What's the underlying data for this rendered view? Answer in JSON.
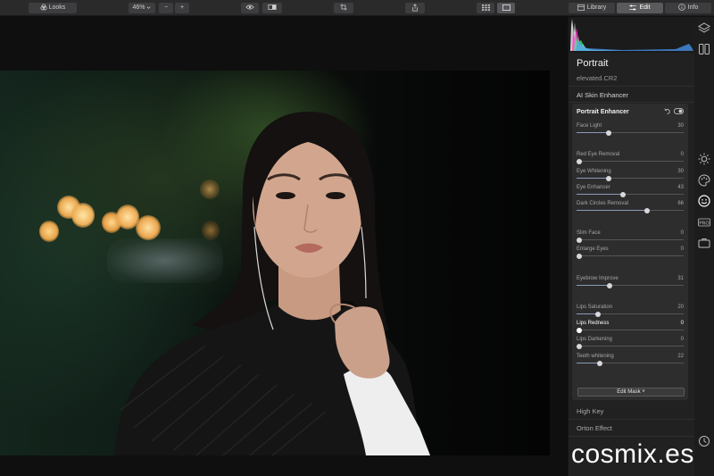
{
  "toolbar": {
    "looks_label": "Looks",
    "zoom_level": "46%",
    "zoom_out": "−",
    "zoom_in": "+"
  },
  "tabs": [
    {
      "label": "Library",
      "icon": "library-icon",
      "active": false
    },
    {
      "label": "Edit",
      "icon": "sliders-icon",
      "active": true
    },
    {
      "label": "Info",
      "icon": "info-icon",
      "active": false
    }
  ],
  "panel": {
    "title": "Portrait",
    "file_name": "elevated.CR2",
    "section_ai_skin": "AI Skin Enhancer",
    "card": {
      "title": "Portrait Enhancer",
      "sliders": [
        {
          "label": "Face Light",
          "value": "30",
          "fraction": 0.3
        },
        {
          "label": "Red Eye Removal",
          "value": "0",
          "fraction": 0.0
        },
        {
          "label": "Eye Whitening",
          "value": "30",
          "fraction": 0.3
        },
        {
          "label": "Eye Enhancer",
          "value": "43",
          "fraction": 0.43
        },
        {
          "label": "Dark Circles Removal",
          "value": "66",
          "fraction": 0.66
        },
        {
          "label": "Slim Face",
          "value": "0",
          "fraction": 0.0
        },
        {
          "label": "Enlarge Eyes",
          "value": "0",
          "fraction": 0.0
        },
        {
          "label": "Eyebrow Improve",
          "value": "31",
          "fraction": 0.31
        },
        {
          "label": "Lips Saturation",
          "value": "20",
          "fraction": 0.2
        },
        {
          "label": "Lips Redness",
          "value": "0",
          "fraction": 0.0
        },
        {
          "label": "Lips Darkening",
          "value": "0",
          "fraction": 0.0
        },
        {
          "label": "Teeth whitening",
          "value": "22",
          "fraction": 0.22
        }
      ],
      "edit_mask": "Edit Mask ˅"
    },
    "section_high_key": "High Key",
    "section_orton": "Orton Effect"
  },
  "colors": {
    "accent": "#8a9bb8",
    "panel_bg": "#212122",
    "card_bg": "#2d2d2e"
  },
  "watermark": "cosmix.es"
}
